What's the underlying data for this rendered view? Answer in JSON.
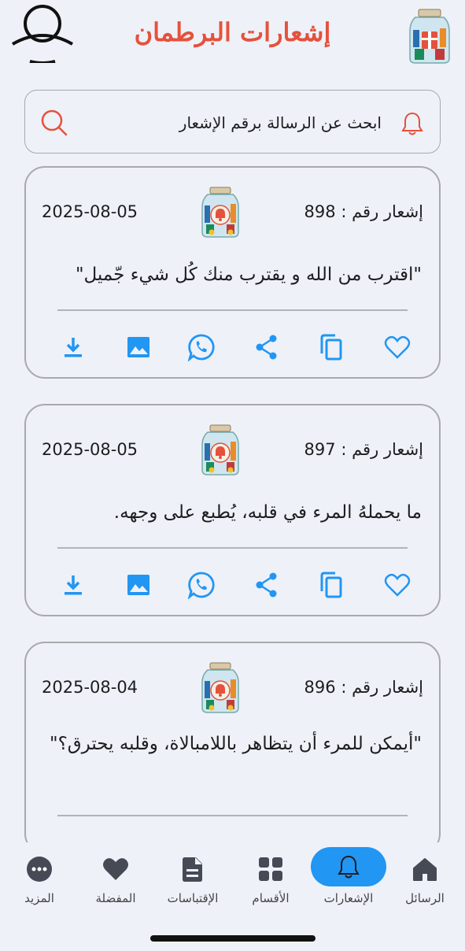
{
  "header": {
    "title": "إشعارات البرطمان",
    "avatar_icon": "user-avatar-icon",
    "logo_icon": "gift-jar-logo-icon"
  },
  "search": {
    "placeholder": "ابحث عن الرسالة برقم الإشعار",
    "bell_icon": "bell-icon",
    "search_icon": "search-icon"
  },
  "colors": {
    "brand_red": "#e5513b",
    "accent_blue": "#2196f3",
    "background": "#eef1f8"
  },
  "cards": [
    {
      "number_label": "إشعار رقم : 898",
      "date": "2025-08-05",
      "message": "\"اقترب من الله و يقترب منك كُل شيء جّميل\""
    },
    {
      "number_label": "إشعار رقم : 897",
      "date": "2025-08-05",
      "message": "ما يحملهُ المرء في قلبه، يُطبع على وجهه."
    },
    {
      "number_label": "إشعار رقم : 896",
      "date": "2025-08-04",
      "message": "\"أيمكن للمرء أن يتظاهر باللامبالاة، وقلبه يحترق؟\""
    }
  ],
  "card_actions": [
    "download-icon",
    "image-icon",
    "whatsapp-icon",
    "share-icon",
    "copy-icon",
    "heart-icon"
  ],
  "nav": {
    "items": [
      {
        "label": "الرسائل",
        "icon": "home-icon",
        "active": false
      },
      {
        "label": "الإشعارات",
        "icon": "bell-icon",
        "active": true
      },
      {
        "label": "الأقسام",
        "icon": "grid-icon",
        "active": false
      },
      {
        "label": "الإقتباسات",
        "icon": "document-icon",
        "active": false
      },
      {
        "label": "المفضلة",
        "icon": "heart-icon",
        "active": false
      },
      {
        "label": "المزيد",
        "icon": "more-icon",
        "active": false
      }
    ]
  }
}
